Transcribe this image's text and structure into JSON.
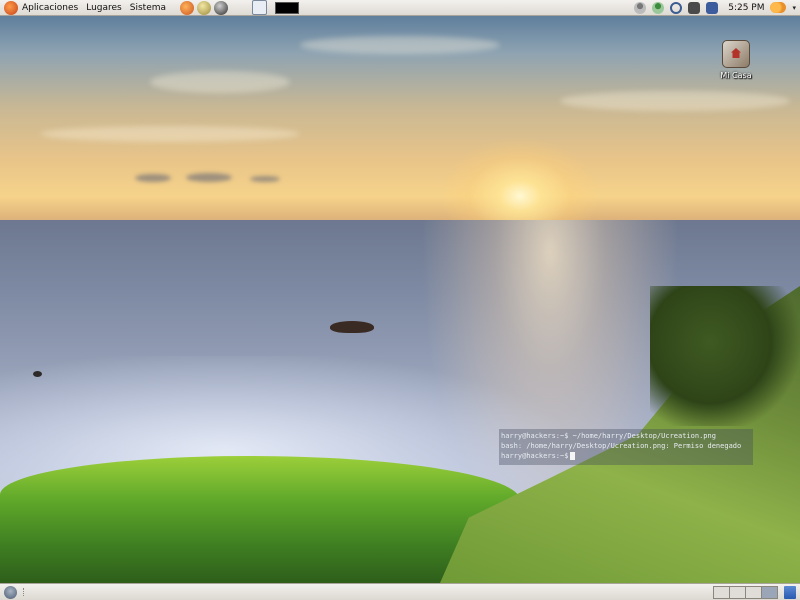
{
  "top_panel": {
    "menus": [
      "Aplicaciones",
      "Lugares",
      "Sistema"
    ],
    "launchers": [
      "firefox-icon",
      "globe-icon",
      "disk-icon",
      "help-icon",
      "terminal-icon"
    ],
    "tray_icons": [
      "user-icon",
      "user-online-icon",
      "search-icon",
      "sound-icon",
      "network-icon"
    ],
    "clock": "5:25 PM",
    "weather_icon": "weather-icon"
  },
  "desktop": {
    "icons": [
      {
        "label": "Mi Casa",
        "icon": "home-icon"
      }
    ]
  },
  "terminal": {
    "lines": [
      "harry@hackers:~$ ~/home/harry/Desktop/Ucreation.png",
      "bash: /home/harry/Desktop/Ucreation.png: Permiso denegado",
      "harry@hackers:~$"
    ]
  },
  "bottom_panel": {
    "workspaces": 4,
    "active_workspace": 4,
    "show_desktop_icon": "show-desktop-icon",
    "trash_icon": "trash-icon"
  },
  "colors": {
    "panel_bg": "#e8e5e0",
    "sky_top": "#5f7f9c",
    "horizon": "#f6d38a",
    "sea": "#8e9ab2",
    "grass": "#5fa82a"
  }
}
